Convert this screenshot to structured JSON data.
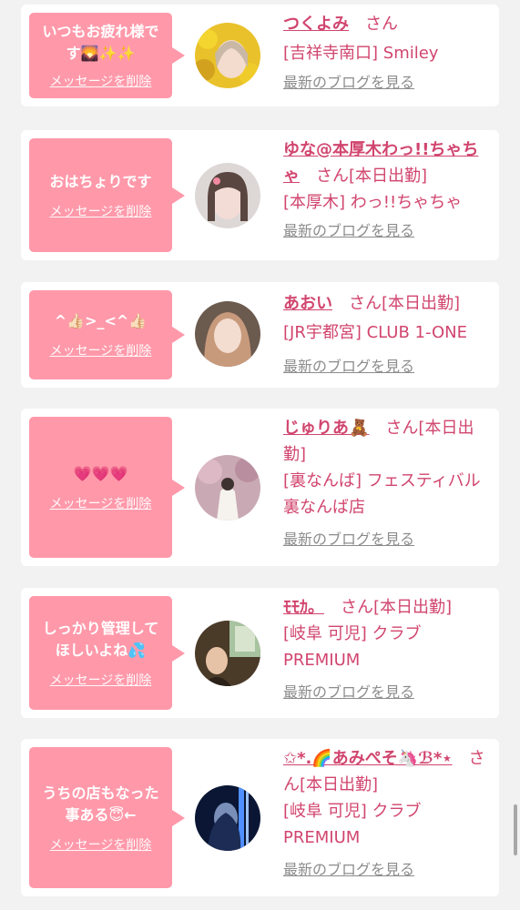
{
  "colors": {
    "bubble": "#ff99aa",
    "accent": "#d1456e",
    "link_gray": "#8c8c8c",
    "bg": "#f2f2f2"
  },
  "delete_label": "メッセージを削除",
  "blog_label": "最新のブログを見る",
  "cards": [
    {
      "message": "いつもお疲れ様です🌄✨✨",
      "name": "つくよみ",
      "san": "さん",
      "shop": "[吉祥寺南口] Smiley",
      "avatar_icon": "avatar-photo"
    },
    {
      "message": "おはちょりです",
      "name": "ゆな@本厚木わっ!!ちゃちゃ",
      "san": "さん[本日出勤]",
      "shop": "[本厚木] わっ!!ちゃちゃ",
      "avatar_icon": "avatar-photo"
    },
    {
      "message": "^👍🏻>_<^👍🏻",
      "name": "あおい",
      "san": "さん[本日出勤]",
      "shop": "[JR宇都宮] CLUB 1-ONE",
      "avatar_icon": "avatar-photo"
    },
    {
      "message": "💗💗💗",
      "name": "じゅりあ🧸",
      "san": "さん[本日出勤]",
      "shop": "[裏なんば] フェスティバル裏なんば店",
      "avatar_icon": "avatar-photo"
    },
    {
      "message": "しっかり管理してほしいよね💦",
      "name": "ﾓﾓｶ。",
      "san": "さん[本日出勤]",
      "shop": "[岐阜 可児] クラブPREMIUM",
      "avatar_icon": "avatar-photo"
    },
    {
      "message": "うちの店もなった事ある😇←",
      "name": "✩*.🌈あみぺそ🦄ℬ*⋆",
      "san": "さん[本日出勤]",
      "shop": "[岐阜 可児] クラブPREMIUM",
      "avatar_icon": "avatar-photo"
    }
  ]
}
